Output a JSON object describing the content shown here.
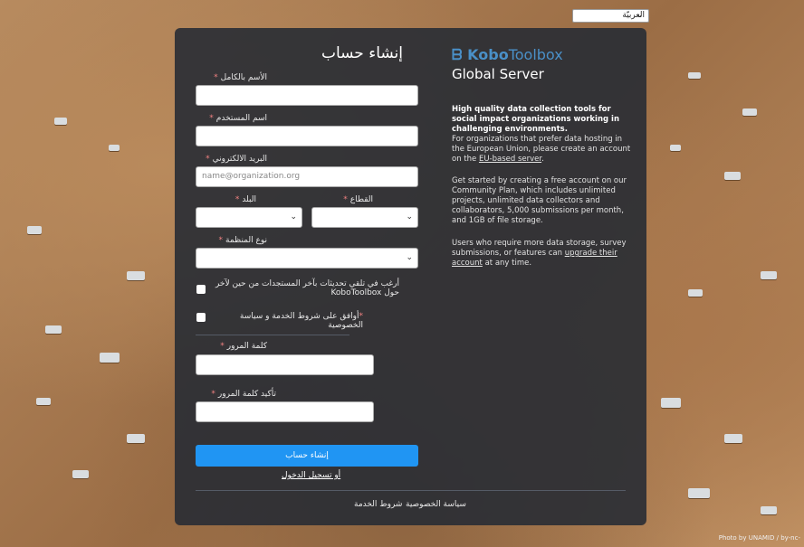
{
  "language": {
    "selected": "العربيّة"
  },
  "form": {
    "title": "إنشاء حساب",
    "full_name_label": "الأسم بالكامل",
    "username_label": "اسم المستخدم",
    "email_label": "البريد الالكتروني",
    "email_placeholder": "name@organization.org",
    "country_label": "البلد",
    "sector_label": "القطاع",
    "org_type_label": "نوع المنظمة",
    "updates_checkbox": "أرغب في تلقي تحديثات بآخر المستجدات من حين لآخر حول KoboToolbox",
    "terms_checkbox": "أوافق على شروط الخدمة و سياسة الخصوصية",
    "password_label": "كلمة المرور",
    "confirm_password_label": "تأكيد كلمة المرور",
    "required_marker": "*",
    "submit_button": "إنشاء حساب",
    "login_link": "أو تسجيل الدخول"
  },
  "footer": {
    "privacy": "سياسة الخصوصية",
    "terms": "شروط الخدمة"
  },
  "info": {
    "logo_kobo": "Kobo",
    "logo_toolbox": "Toolbox",
    "server": "Global Server",
    "tagline": "High quality data collection tools for social impact organizations working in challenging environments.",
    "eu_text_before": "For organizations that prefer data hosting in the European Union, please create an account on the ",
    "eu_link": "EU-based server",
    "eu_text_after": ".",
    "community_text": "Get started by creating a free account on our Community Plan, which includes unlimited projects, unlimited data collectors and collaborators, 5,000 submissions per month, and 1GB of file storage.",
    "upgrade_before": "Users who require more data storage, survey submissions, or features can ",
    "upgrade_link": "upgrade their account",
    "upgrade_after": " at any time."
  },
  "credit": "Photo by UNAMID / by-nc-",
  "colors": {
    "accent": "#2095f3",
    "panel": "#282c34",
    "required": "#f08080"
  }
}
